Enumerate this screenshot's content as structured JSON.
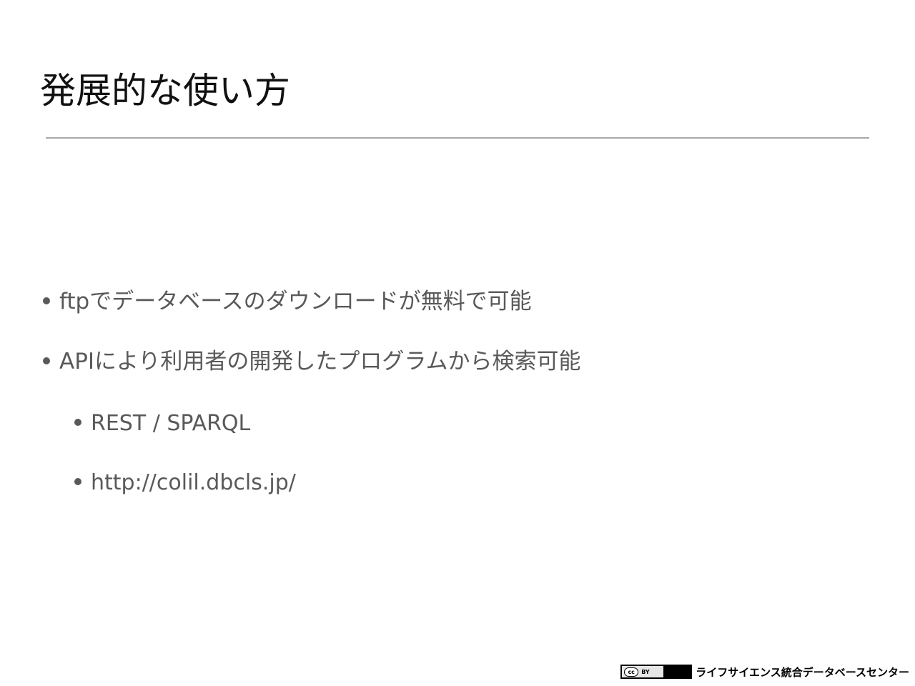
{
  "slide": {
    "title": "発展的な使い方",
    "bullets": [
      {
        "text": "ftpでデータベースのダウンロードが無料で可能"
      },
      {
        "text": "APIにより利用者の開発したプログラムから検索可能"
      },
      {
        "text": "REST / SPARQL"
      },
      {
        "text": "http://colil.dbcls.jp/"
      }
    ]
  },
  "footer": {
    "license_badge": {
      "cc_label": "cc",
      "by_label": "BY"
    },
    "organization": "ライフサイエンス統合データベースセンター"
  },
  "colors": {
    "title": "#111111",
    "body_text": "#595959",
    "rule": "#a9a9a9",
    "background": "#ffffff"
  }
}
